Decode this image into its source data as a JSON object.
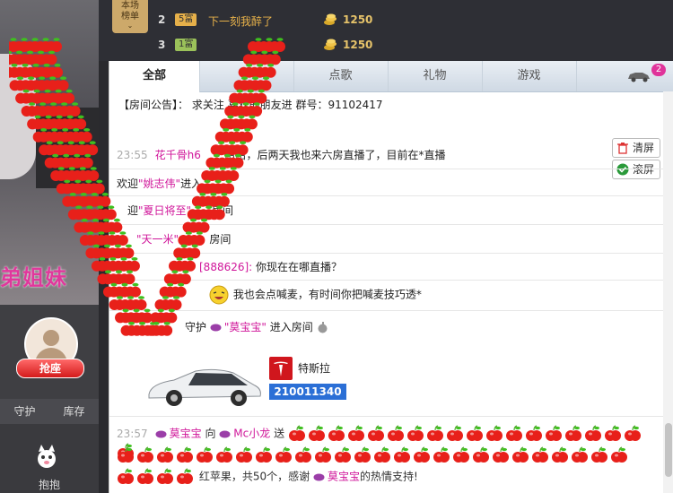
{
  "left": {
    "overlay_text": "弟姐妹",
    "grab_seat_label": "抢座",
    "tabs": [
      "守护",
      "库存"
    ],
    "hug_label": "抱抱"
  },
  "rank": {
    "badge": "本场\n榜单",
    "rows": [
      {
        "num": "2",
        "level": "5富",
        "level_color": "#e6b04a",
        "name": "下一刻我醉了",
        "score": "1250"
      },
      {
        "num": "3",
        "level": "1富",
        "level_color": "#9bc25a",
        "name": "",
        "score": "1250"
      }
    ]
  },
  "tabs": {
    "all": "全部",
    "song": "点歌",
    "gift": "礼物",
    "game": "游戏",
    "car_count": "2"
  },
  "announcement": "【房间公告】： 求关注 喜欢的朋友进 群号：91102417",
  "buttons": {
    "clear": "清屏",
    "scroll": "滚屏"
  },
  "chat": {
    "m1_time": "23:55",
    "m1_name": "花千骨h6",
    "m1_text": "哈哈，后两天我也来六房直播了，目前在*直播",
    "m2_text": "欢迎",
    "m2_name": "\"姚志伟\"",
    "m2_tail": "进入",
    "m3_text": "迎",
    "m3_name": "\"夏日将至\"",
    "m3_tail": "房间",
    "m4_name": "\"天一米\"",
    "m4_tail": "房间",
    "m5_name": "[888626]:",
    "m5_text": "你现在在哪直播？",
    "m6_text": "我也会点喊麦，有时间你把喊麦技巧透*",
    "m7_text": "守护",
    "m7_name": "\"莫宝宝\"",
    "m7_tail": "进入房间",
    "tesla_name": "特斯拉",
    "tesla_id": "210011340",
    "gift_time": "23:57",
    "gift_from": "莫宝宝",
    "gift_to_word": "向",
    "gift_to": "Mc小龙",
    "gift_send": "送",
    "gift_summary": "红苹果，共50个，感谢",
    "gift_thanks_name": "莫宝宝",
    "gift_thanks_tail": "的热情支持!"
  },
  "colors": {
    "accent": "#d0169a",
    "apple": "#e8201a",
    "leaf": "#3fbf1f"
  }
}
